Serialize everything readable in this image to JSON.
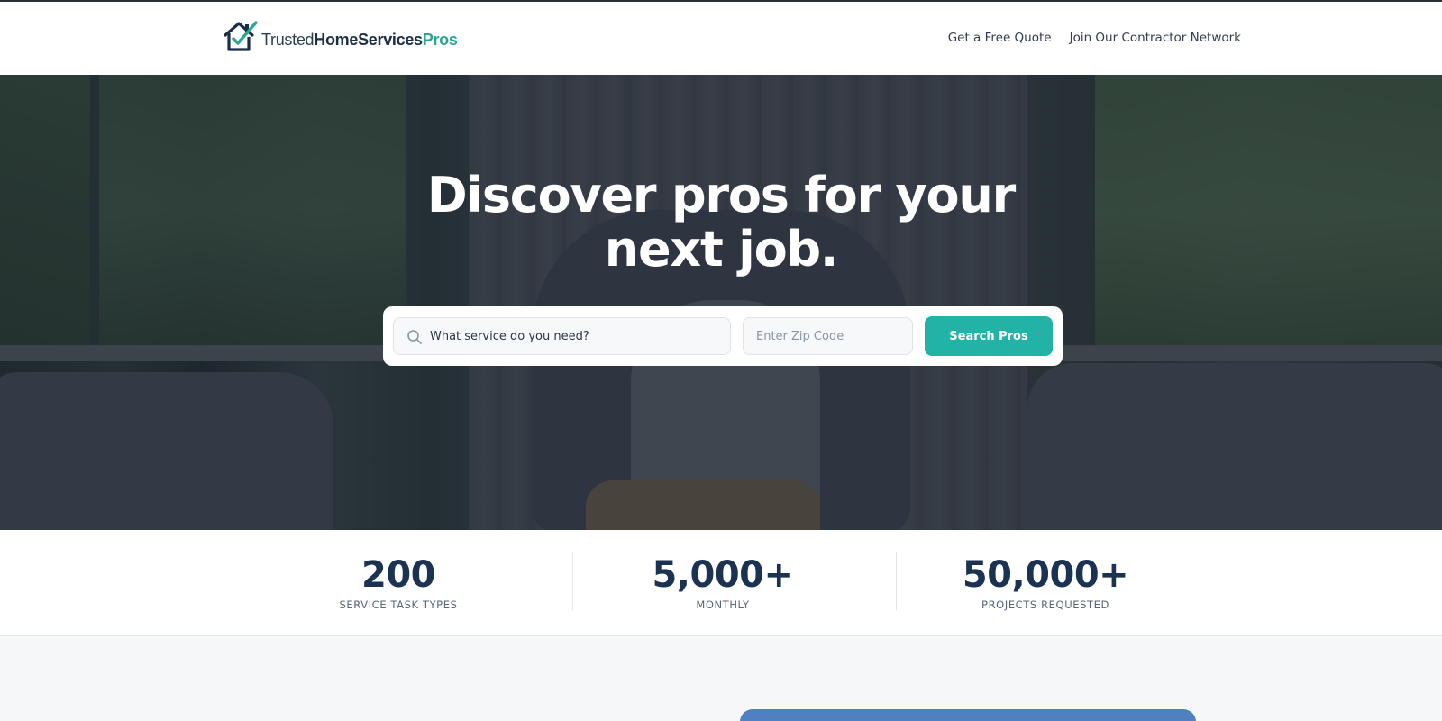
{
  "brand": {
    "part1": "Trusted",
    "part2": "HomeServices",
    "part3": "Pros",
    "colors": {
      "navy": "#1b2e48",
      "teal": "#2aa692"
    }
  },
  "nav": {
    "items": [
      {
        "label": "Get a Free Quote"
      },
      {
        "label": "Join Our Contractor Network"
      }
    ]
  },
  "hero": {
    "title": "Discover pros for your next job.",
    "search": {
      "service_placeholder": "What service do you need?",
      "zip_placeholder": "Enter Zip Code",
      "button_label": "Search Pros",
      "icon": "search-icon",
      "button_color": "#23b3a6"
    }
  },
  "stats": [
    {
      "value": "200",
      "label": "SERVICE TASK TYPES"
    },
    {
      "value": "5,000+",
      "label": "MONTHLY"
    },
    {
      "value": "50,000+",
      "label": "PROJECTS REQUESTED"
    }
  ]
}
